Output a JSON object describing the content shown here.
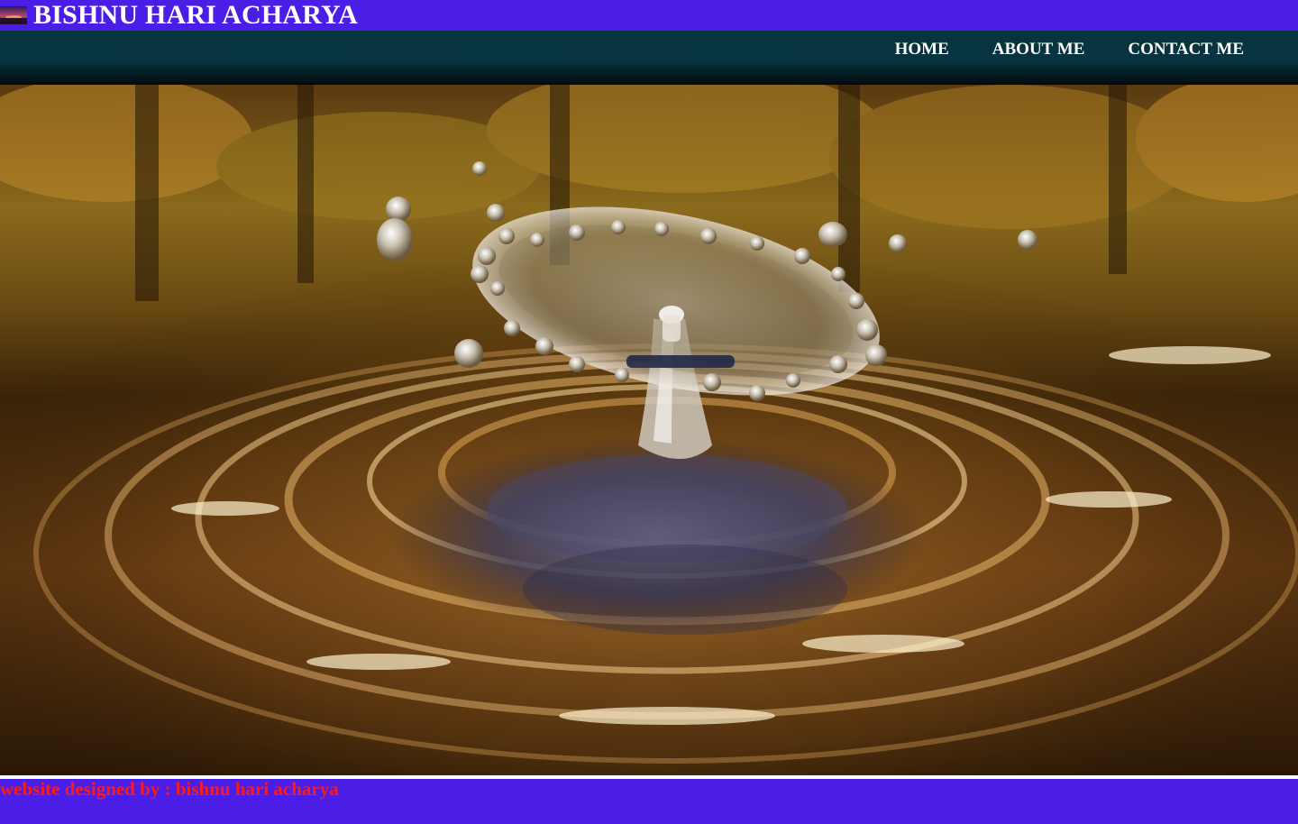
{
  "header": {
    "title": "BISHNU HARI ACHARYA",
    "logo_icon": "sunset-logo-icon",
    "background_color": "#4a1ee6"
  },
  "nav": {
    "items": [
      {
        "label": "HOME"
      },
      {
        "label": "ABOUT ME"
      },
      {
        "label": "CONTACT ME"
      }
    ]
  },
  "hero": {
    "image_subject": "water-drop-splash-photo"
  },
  "footer": {
    "text": "website designed by : bishnu hari acharya",
    "text_color": "#ff1a1a",
    "background_color": "#4a1ee6"
  }
}
